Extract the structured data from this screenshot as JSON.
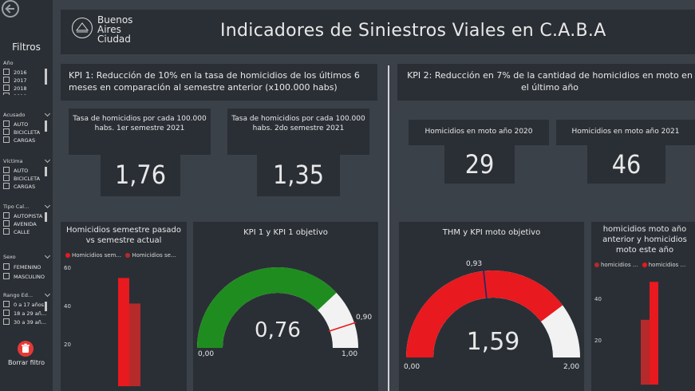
{
  "sidebar": {
    "title": "Filtros",
    "groups": {
      "anio": {
        "title": "Año",
        "options": [
          "2016",
          "2017",
          "2018",
          "2019"
        ]
      },
      "acusado": {
        "title": "Acusado",
        "options": [
          "AUTO",
          "BICICLETA",
          "CARGAS"
        ]
      },
      "victima": {
        "title": "Víctima",
        "options": [
          "AUTO",
          "BICICLETA",
          "CARGAS"
        ]
      },
      "tipo_calle": {
        "title": "Tipo Cal...",
        "options": [
          "AUTOPISTA",
          "AVENIDA",
          "CALLE"
        ]
      },
      "sexo": {
        "title": "Sexo",
        "options": [
          "FEMENINO",
          "MASCULINO"
        ]
      },
      "rango_edad": {
        "title": "Rango Ed...",
        "options": [
          "0 a 17 años",
          "18 a 29 añ...",
          "30 a 39 añ..."
        ]
      }
    },
    "clear_label": "Borrar filtro"
  },
  "header": {
    "logo_text": "Buenos\nAires\nCiudad",
    "title": "Indicadores de Siniestros Viales en C.A.B.A"
  },
  "kpi1": {
    "heading": "KPI 1: Reducción de 10% en la tasa de homicidios de los últimos 6 meses en comparación al semestre anterior (x100.000 habs)",
    "card1_label": "Tasa de homicidios por cada 100.000 habs. 1er semestre 2021",
    "card1_value": "1,76",
    "card2_label": "Tasa de homicidios por cada 100.000 habs. 2do semestre 2021",
    "card2_value": "1,35"
  },
  "kpi2": {
    "heading": "KPI 2: Reducción en 7% de la cantidad de homicidios en moto en el último año",
    "card1_label": "Homicidios en moto año 2020",
    "card1_value": "29",
    "card2_label": "Homicidios en moto año 2021",
    "card2_value": "46"
  },
  "colors": {
    "red": "#e8191f",
    "dark_red": "#b52a2a",
    "green": "#1f8c1f",
    "gauge_bg": "#f2f2f2"
  },
  "charts": {
    "semestre": {
      "title": "Homicidios semestre pasado vs semestre actual",
      "legend": [
        "Homicidios sem...",
        "Homicidios se..."
      ],
      "yticks": [
        "60",
        "40",
        "20"
      ]
    },
    "kpi1_gauge": {
      "title": "KPI 1 y KPI 1 objetivo",
      "value_label": "0,76",
      "min_label": "0,00",
      "max_label": "1,00",
      "target_label": "0,90"
    },
    "moto_gauge": {
      "title": "THM y KPI moto objetivo",
      "value_label": "1,59",
      "min_label": "0,00",
      "max_label": "2,00",
      "target_label": "0,93"
    },
    "moto_bars": {
      "title": "homicidios moto año anterior y homicidios moto este año",
      "legend": [
        "homicidios ...",
        "homicidios ..."
      ],
      "yticks": [
        "40",
        "20"
      ]
    }
  },
  "chart_data": [
    {
      "type": "bar",
      "title": "Homicidios semestre pasado vs semestre actual",
      "series": [
        {
          "name": "Homicidios sem...",
          "values": [
            55
          ]
        },
        {
          "name": "Homicidios se...",
          "values": [
            42
          ]
        }
      ],
      "ylim": [
        0,
        60
      ]
    },
    {
      "type": "gauge",
      "title": "KPI 1 y KPI 1 objetivo",
      "value": 0.76,
      "min": 0,
      "max": 1,
      "target": 0.9
    },
    {
      "type": "gauge",
      "title": "THM y KPI moto objetivo",
      "value": 1.59,
      "min": 0,
      "max": 2,
      "target": 0.93
    },
    {
      "type": "bar",
      "title": "homicidios moto año anterior y homicidios moto este año",
      "series": [
        {
          "name": "homicidios ...",
          "values": [
            29
          ]
        },
        {
          "name": "homicidios ...",
          "values": [
            46
          ]
        }
      ],
      "ylim": [
        0,
        50
      ]
    }
  ]
}
